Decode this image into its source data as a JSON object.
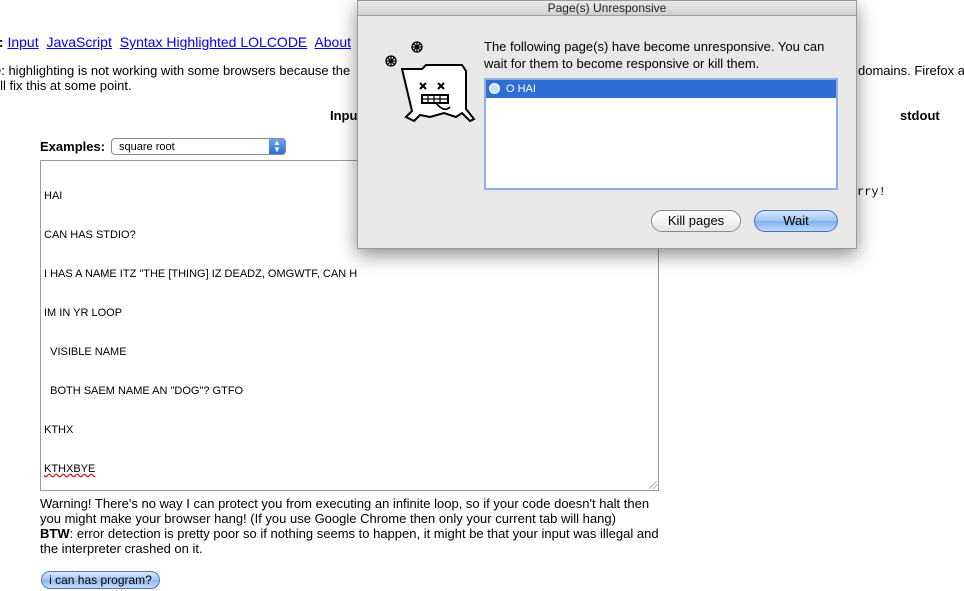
{
  "page": {
    "nav": {
      "prefix": "w:",
      "links": [
        "Input",
        "JavaScript",
        "Syntax Highlighted LOLCODE",
        "About"
      ]
    },
    "note_line1": "e: highlighting is not working with some browsers because the",
    "note_line1_right": "domains. Firefox a",
    "note_line2": "I'll fix this at some point.",
    "input_heading": "Inpu",
    "stdout_heading": "stdout",
    "stdout_partial": "rry!",
    "examples_label": "Examples:",
    "examples_selected": "square root",
    "code_lines": [
      "HAI",
      "CAN HAS STDIO?",
      "I HAS A NAME ITZ \"THE [THING] IZ DEADZ, OMGWTF, CAN H",
      "IM IN YR LOOP",
      "  VISIBLE NAME",
      "  BOTH SAEM NAME AN \"DOG\"? GTFO",
      "KTHX",
      "KTHXBYE"
    ],
    "warning": "Warning! There's no way I can protect you from executing an infinite loop, so if your code doesn't halt then you might make your browser hang! (If you use Google Chrome then only your current tab will hang)",
    "btw_label": "BTW",
    "btw_text": ": error detection is pretty poor so if nothing seems to happen, it might be that your input was illegal and the interpreter crashed on it.",
    "run_button": "i can has program?"
  },
  "dialog": {
    "title": "Page(s) Unresponsive",
    "message": "The following page(s) have become unresponsive. You can wait for them to become responsive or kill them.",
    "pages": [
      "O HAI"
    ],
    "kill_button": "Kill pages",
    "wait_button": "Wait",
    "icon": "sad-tab-icon"
  },
  "colors": {
    "selection": "#2f6fd4",
    "link": "#0000ee",
    "dialog_bg": "#e8e8e8"
  }
}
